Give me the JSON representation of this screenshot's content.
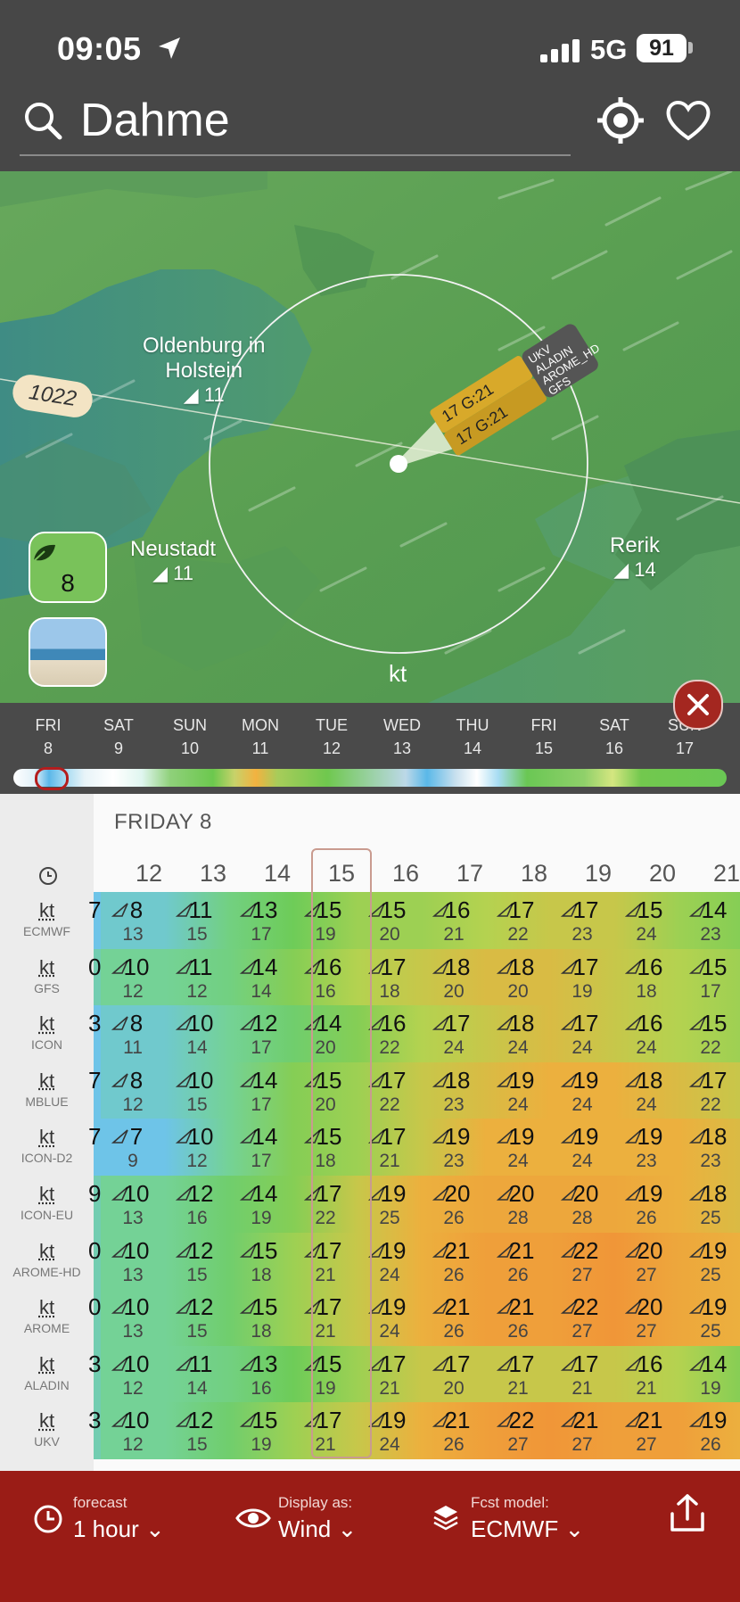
{
  "status": {
    "time": "09:05",
    "network": "5G",
    "battery": "91"
  },
  "search": {
    "location": "Dahme"
  },
  "map": {
    "labels": [
      {
        "name": "Oldenburg in",
        "name2": "Holstein",
        "speed": "11"
      },
      {
        "name": "Neustadt",
        "speed": "11"
      },
      {
        "name": "Rerik",
        "speed": "14"
      }
    ],
    "pressure": "1022",
    "eco_value": "8",
    "unit": "kt",
    "flag_models": [
      "UKV",
      "ALADIN",
      "AROME_HD",
      "GFS"
    ],
    "flag_values": [
      "17 G:21",
      "17 G:21"
    ]
  },
  "timeline": {
    "days": [
      {
        "dow": "FRI",
        "num": "8"
      },
      {
        "dow": "SAT",
        "num": "9"
      },
      {
        "dow": "SUN",
        "num": "10"
      },
      {
        "dow": "MON",
        "num": "11"
      },
      {
        "dow": "TUE",
        "num": "12"
      },
      {
        "dow": "WED",
        "num": "13"
      },
      {
        "dow": "THU",
        "num": "14"
      },
      {
        "dow": "FRI",
        "num": "15"
      },
      {
        "dow": "SAT",
        "num": "16"
      },
      {
        "dow": "SUN",
        "num": "17"
      }
    ]
  },
  "table": {
    "day_title": "FRIDAY 8",
    "unit": "kt",
    "hours": [
      "12",
      "13",
      "14",
      "15",
      "16",
      "17",
      "18",
      "19",
      "20",
      "21"
    ],
    "models": [
      {
        "name": "ECMWF",
        "prev": "7",
        "wind": [
          "8",
          "11",
          "13",
          "15",
          "15",
          "16",
          "17",
          "17",
          "15",
          "14"
        ],
        "gust": [
          "13",
          "15",
          "17",
          "19",
          "20",
          "21",
          "22",
          "23",
          "24",
          "23"
        ]
      },
      {
        "name": "GFS",
        "prev": "0",
        "wind": [
          "10",
          "11",
          "14",
          "16",
          "17",
          "18",
          "18",
          "17",
          "16",
          "15"
        ],
        "gust": [
          "12",
          "12",
          "14",
          "16",
          "18",
          "20",
          "20",
          "19",
          "18",
          "17"
        ]
      },
      {
        "name": "ICON",
        "prev": "3",
        "wind": [
          "8",
          "10",
          "12",
          "14",
          "16",
          "17",
          "18",
          "17",
          "16",
          "15"
        ],
        "gust": [
          "11",
          "14",
          "17",
          "20",
          "22",
          "24",
          "24",
          "24",
          "24",
          "22"
        ]
      },
      {
        "name": "MBLUE",
        "prev": "7",
        "wind": [
          "8",
          "10",
          "14",
          "15",
          "17",
          "18",
          "19",
          "19",
          "18",
          "17"
        ],
        "gust": [
          "12",
          "15",
          "17",
          "20",
          "22",
          "23",
          "24",
          "24",
          "24",
          "22"
        ]
      },
      {
        "name": "ICON-D2",
        "prev": "7",
        "wind": [
          "7",
          "10",
          "14",
          "15",
          "17",
          "19",
          "19",
          "19",
          "19",
          "18"
        ],
        "gust": [
          "9",
          "12",
          "17",
          "18",
          "21",
          "23",
          "24",
          "24",
          "23",
          "23"
        ]
      },
      {
        "name": "ICON-EU",
        "prev": "9",
        "wind": [
          "10",
          "12",
          "14",
          "17",
          "19",
          "20",
          "20",
          "20",
          "19",
          "18"
        ],
        "gust": [
          "13",
          "16",
          "19",
          "22",
          "25",
          "26",
          "28",
          "28",
          "26",
          "25"
        ]
      },
      {
        "name": "AROME-HD",
        "prev": "0",
        "wind": [
          "10",
          "12",
          "15",
          "17",
          "19",
          "21",
          "21",
          "22",
          "20",
          "19"
        ],
        "gust": [
          "13",
          "15",
          "18",
          "21",
          "24",
          "26",
          "26",
          "27",
          "27",
          "25"
        ]
      },
      {
        "name": "AROME",
        "prev": "0",
        "wind": [
          "10",
          "12",
          "15",
          "17",
          "19",
          "21",
          "21",
          "22",
          "20",
          "19"
        ],
        "gust": [
          "13",
          "15",
          "18",
          "21",
          "24",
          "26",
          "26",
          "27",
          "27",
          "25"
        ]
      },
      {
        "name": "ALADIN",
        "prev": "3",
        "wind": [
          "10",
          "11",
          "13",
          "15",
          "17",
          "17",
          "17",
          "17",
          "16",
          "14"
        ],
        "gust": [
          "12",
          "14",
          "16",
          "19",
          "21",
          "20",
          "21",
          "21",
          "21",
          "19"
        ]
      },
      {
        "name": "UKV",
        "prev": "3",
        "wind": [
          "10",
          "12",
          "15",
          "17",
          "19",
          "21",
          "22",
          "21",
          "21",
          "19"
        ],
        "gust": [
          "12",
          "15",
          "19",
          "21",
          "24",
          "26",
          "27",
          "27",
          "27",
          "26"
        ]
      }
    ]
  },
  "bottom": {
    "forecast_label": "forecast",
    "forecast_value": "1 hour",
    "display_label": "Display as:",
    "display_value": "Wind",
    "model_label": "Fcst model:",
    "model_value": "ECMWF"
  },
  "colors": {
    "accent": "#9a1c16",
    "header": "#474747",
    "map_land": "#5a9a56",
    "sea": "#3e8a8a"
  }
}
